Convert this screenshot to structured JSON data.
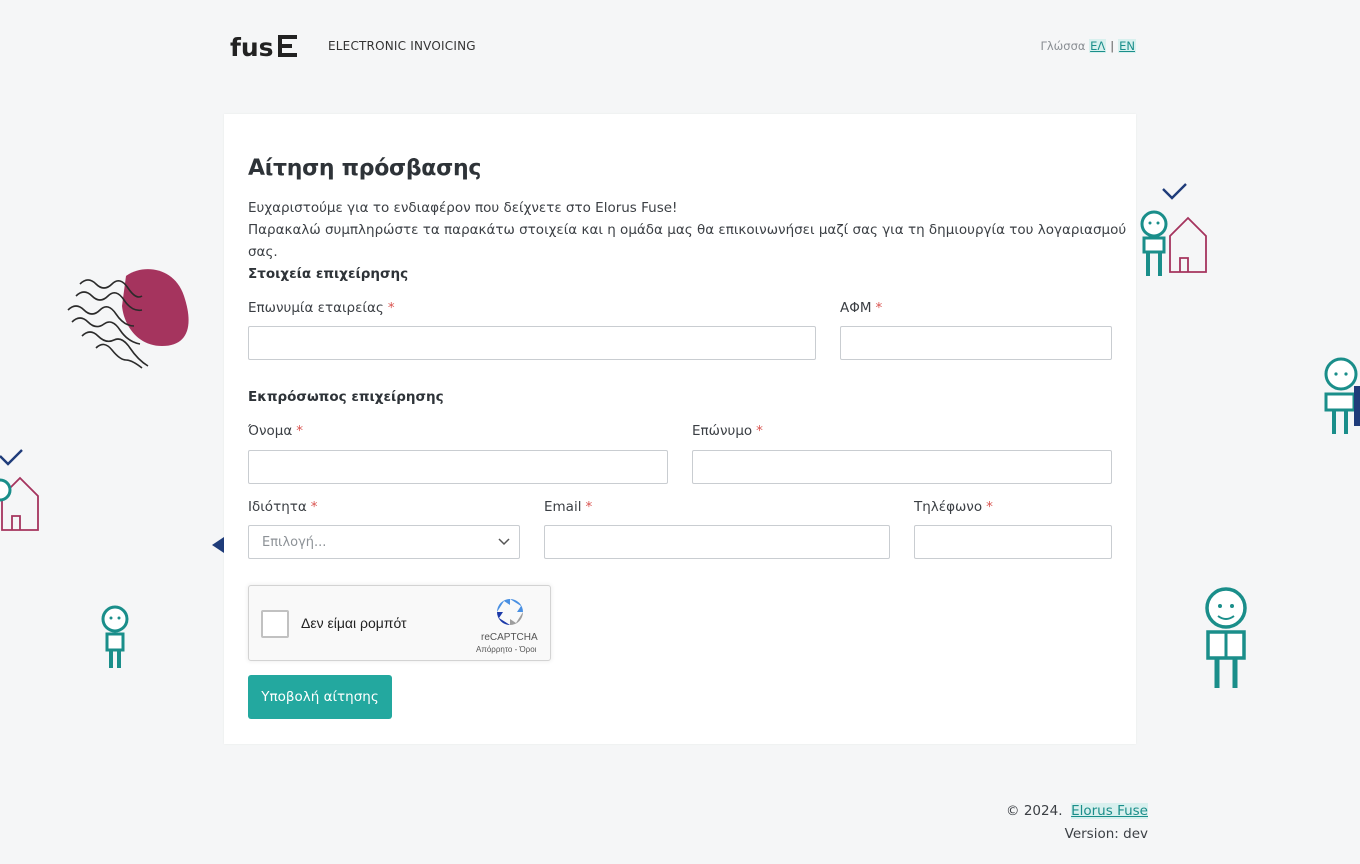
{
  "header": {
    "app_name": "ELECTRONIC INVOICING",
    "language": {
      "label": "Γλώσσα",
      "options": [
        "ΕΛ",
        "EN"
      ],
      "separator": "|"
    }
  },
  "form": {
    "title": "Αίτηση πρόσβασης",
    "intro_line1": "Ευχαριστούμε για το ενδιαφέρον που δείχνετε στο Elorus Fuse!",
    "intro_line2": "Παρακαλώ συμπληρώστε τα παρακάτω στοιχεία και η ομάδα μας θα επικοινωνήσει μαζί σας για τη δημιουργία του λογαριασμού σας.",
    "business_section": "Στοιχεία επιχείρησης",
    "company_name_label": "Επωνυμία εταιρείας",
    "vat_label": "ΑΦΜ",
    "representative_section": "Εκπρόσωπος επιχείρησης",
    "first_name_label": "Όνομα",
    "last_name_label": "Επώνυμο",
    "role_label": "Ιδιότητα",
    "role_placeholder": "Επιλογή...",
    "email_label": "Email",
    "phone_label": "Τηλέφωνο",
    "required_mark": "*",
    "submit_label": "Υποβολή αίτησης"
  },
  "captcha": {
    "text": "Δεν είμαι ρομπότ",
    "brand": "reCAPTCHA",
    "links": "Απόρρητο - Όροι"
  },
  "footer": {
    "copyright": "© 2024.",
    "link": "Elorus Fuse",
    "version": "Version: dev"
  },
  "colors": {
    "accent": "#23a89f",
    "required": "#d9534f",
    "background": "#f5f6f7"
  }
}
